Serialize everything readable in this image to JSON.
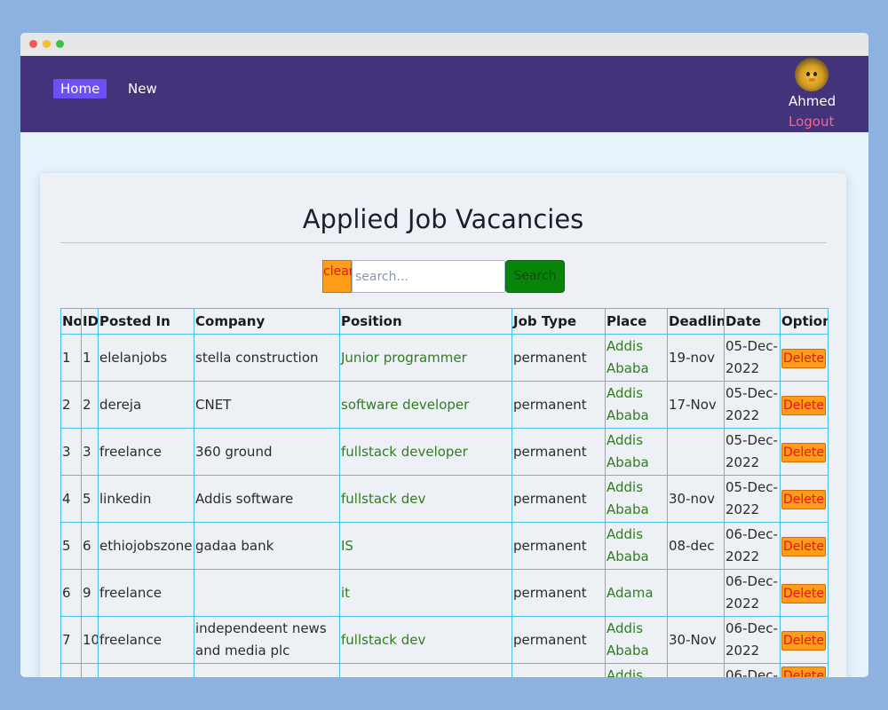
{
  "nav": {
    "home_label": "Home",
    "new_label": "New",
    "user_name": "Ahmed",
    "logout_label": "Logout"
  },
  "page": {
    "title": "Applied Job Vacancies"
  },
  "search": {
    "clear_label": "clear",
    "placeholder": "search...",
    "value": "",
    "button_label": "Search"
  },
  "table": {
    "headers": [
      "No",
      "ID",
      "Posted In",
      "Company",
      "Position",
      "Job Type",
      "Place",
      "Deadline",
      "Date",
      "Option"
    ],
    "delete_label": "Delete",
    "rows": [
      {
        "no": "1",
        "id": "1",
        "posted_in": "elelanjobs",
        "company": "stella construction",
        "position": "Junior programmer",
        "job_type": "permanent",
        "place": "Addis Ababa",
        "deadline": "19-nov",
        "date": "05-Dec-2022"
      },
      {
        "no": "2",
        "id": "2",
        "posted_in": "dereja",
        "company": "CNET",
        "position": "software developer",
        "job_type": "permanent",
        "place": "Addis Ababa",
        "deadline": "17-Nov",
        "date": "05-Dec-2022"
      },
      {
        "no": "3",
        "id": "3",
        "posted_in": "freelance",
        "company": "360 ground",
        "position": "fullstack developer",
        "job_type": "permanent",
        "place": "Addis Ababa",
        "deadline": "",
        "date": "05-Dec-2022"
      },
      {
        "no": "4",
        "id": "5",
        "posted_in": "linkedin",
        "company": "Addis software",
        "position": "fullstack dev",
        "job_type": "permanent",
        "place": "Addis Ababa",
        "deadline": "30-nov",
        "date": "05-Dec-2022"
      },
      {
        "no": "5",
        "id": "6",
        "posted_in": "ethiojobszone",
        "company": "gadaa bank",
        "position": "IS",
        "job_type": "permanent",
        "place": "Addis Ababa",
        "deadline": "08-dec",
        "date": "06-Dec-2022"
      },
      {
        "no": "6",
        "id": "9",
        "posted_in": "freelance",
        "company": "",
        "position": "it",
        "job_type": "permanent",
        "place": "Adama",
        "deadline": "",
        "date": "06-Dec-2022"
      },
      {
        "no": "7",
        "id": "10",
        "posted_in": "freelance",
        "company": "independeent news and media plc",
        "position": "fullstack dev",
        "job_type": "permanent",
        "place": "Addis Ababa",
        "deadline": "30-Nov",
        "date": "06-Dec-2022"
      },
      {
        "no": "",
        "id": "",
        "posted_in": "",
        "company": "",
        "position": "",
        "job_type": "",
        "place": "Addis",
        "deadline": "",
        "date": "06-Dec-"
      }
    ]
  }
}
